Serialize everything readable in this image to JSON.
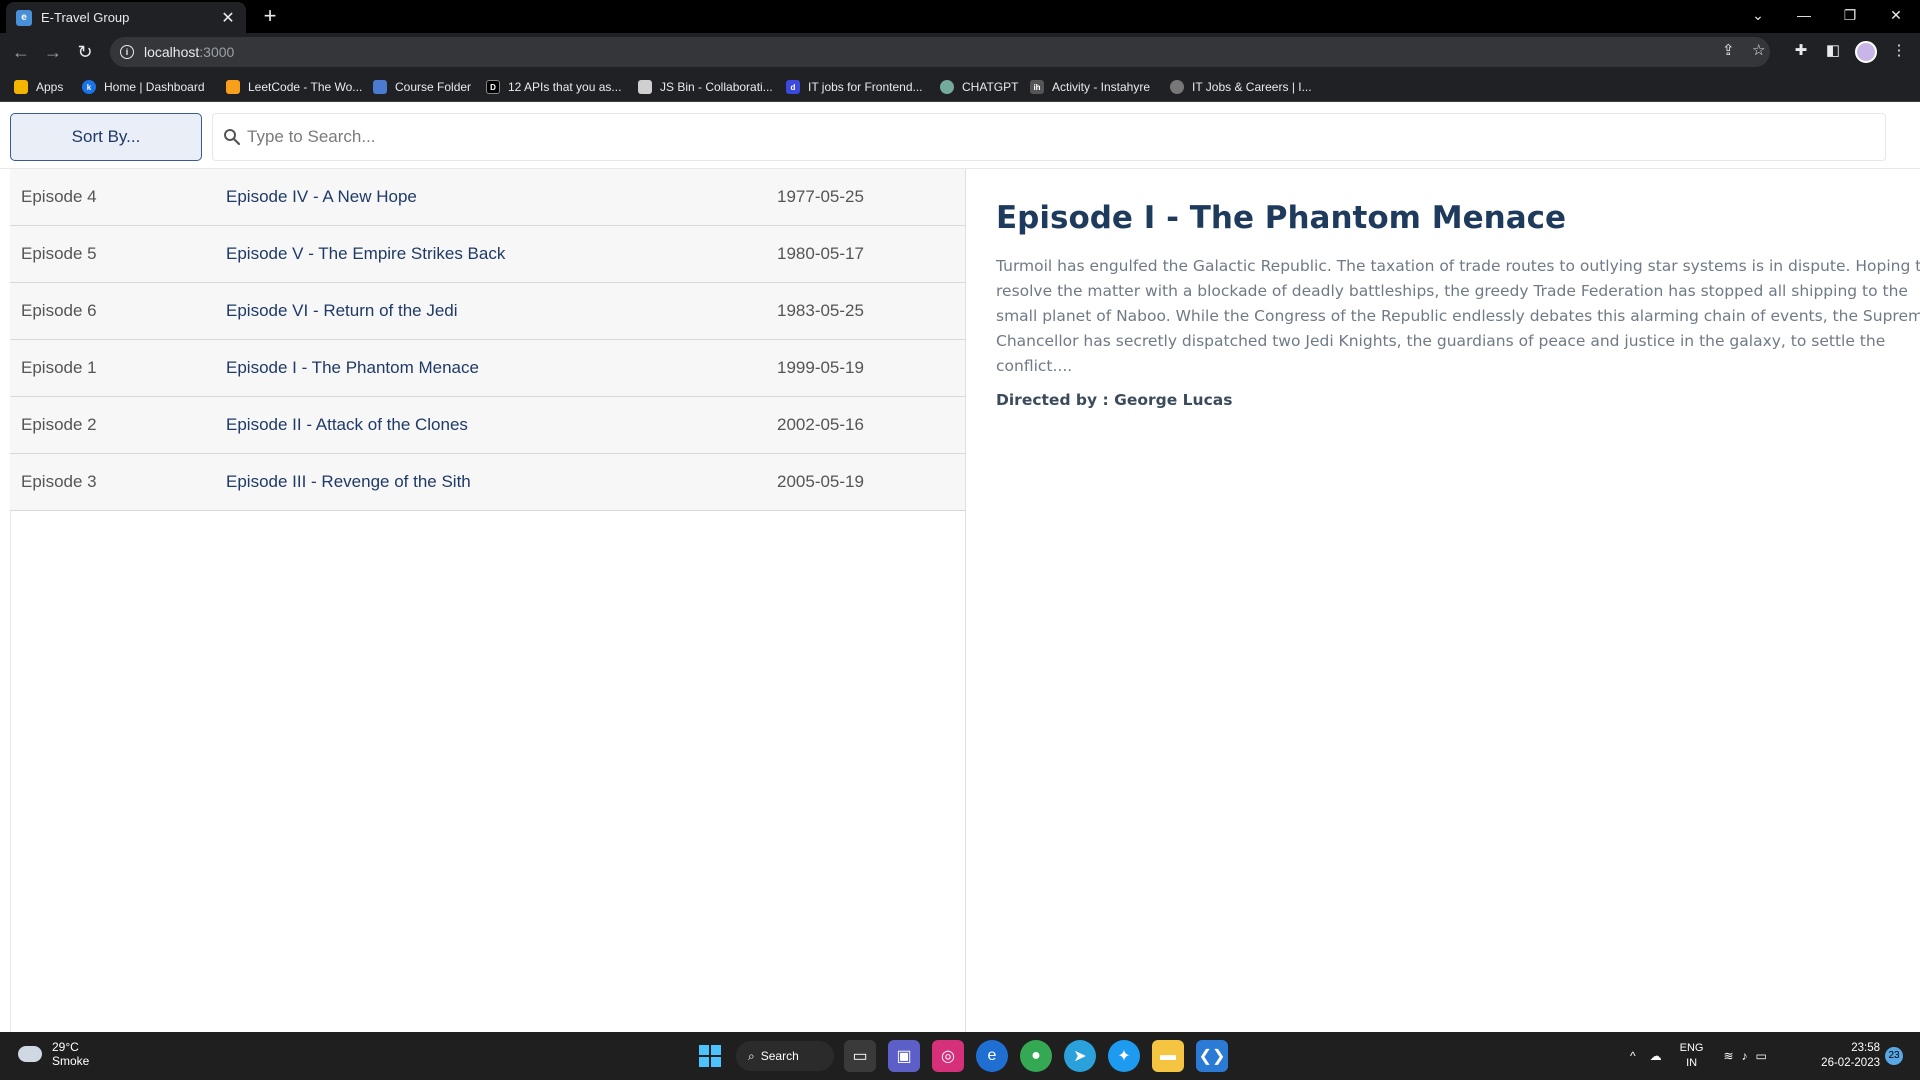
{
  "browser": {
    "tab_title": "E-Travel Group",
    "tab_close": "✕",
    "new_tab": "+",
    "url_host": "localhost",
    "url_port": ":3000",
    "bookmarks": [
      {
        "label": "Apps",
        "icon": "apps-grid-icon",
        "color": "#f4b400"
      },
      {
        "label": "Home | Dashboard",
        "icon": "k-icon",
        "color": "#1a73e8"
      },
      {
        "label": "LeetCode - The Wo...",
        "icon": "leetcode-icon",
        "color": "#f89f1b"
      },
      {
        "label": "Course Folder",
        "icon": "folder-icon",
        "color": "#4a7bd0"
      },
      {
        "label": "12 APIs that you as...",
        "icon": "dev-icon",
        "color": "#000000"
      },
      {
        "label": "JS Bin - Collaborati...",
        "icon": "jsbin-icon",
        "color": "#cfcfcf"
      },
      {
        "label": "IT jobs for Frontend...",
        "icon": "dev-blue-icon",
        "color": "#3b49df"
      },
      {
        "label": "CHATGPT",
        "icon": "chatgpt-icon",
        "color": "#74aa9c"
      },
      {
        "label": "Activity - Instahyre",
        "icon": "instahyre-icon",
        "color": "#555555"
      },
      {
        "label": "IT Jobs & Careers | I...",
        "icon": "jobs-icon",
        "color": "#777777"
      }
    ]
  },
  "app": {
    "sort_label": "Sort By...",
    "search_placeholder": "Type to Search...",
    "episodes": [
      {
        "episode": "Episode 4",
        "title": "Episode IV - A New Hope",
        "date": "1977-05-25"
      },
      {
        "episode": "Episode 5",
        "title": "Episode V - The Empire Strikes Back",
        "date": "1980-05-17"
      },
      {
        "episode": "Episode 6",
        "title": "Episode VI - Return of the Jedi",
        "date": "1983-05-25"
      },
      {
        "episode": "Episode 1",
        "title": "Episode I - The Phantom Menace",
        "date": "1999-05-19"
      },
      {
        "episode": "Episode 2",
        "title": "Episode II - Attack of the Clones",
        "date": "2002-05-16"
      },
      {
        "episode": "Episode 3",
        "title": "Episode III - Revenge of the Sith",
        "date": "2005-05-19"
      }
    ],
    "detail": {
      "title": "Episode I - The Phantom Menace",
      "crawl": "Turmoil has engulfed the Galactic Republic. The taxation of trade routes to outlying star systems is in dispute. Hoping to resolve the matter with a blockade of deadly battleships, the greedy Trade Federation has stopped all shipping to the small planet of Naboo. While the Congress of the Republic endlessly debates this alarming chain of events, the Supreme Chancellor has secretly dispatched two Jedi Knights, the guardians of peace and justice in the galaxy, to settle the conflict....",
      "director": "Directed by : George Lucas"
    }
  },
  "taskbar": {
    "temp": "29°C",
    "weather": "Smoke",
    "search_label": "Search",
    "lang_top": "ENG",
    "lang_bottom": "IN",
    "time": "23:58",
    "date": "26-02-2023",
    "notifications": "23"
  }
}
